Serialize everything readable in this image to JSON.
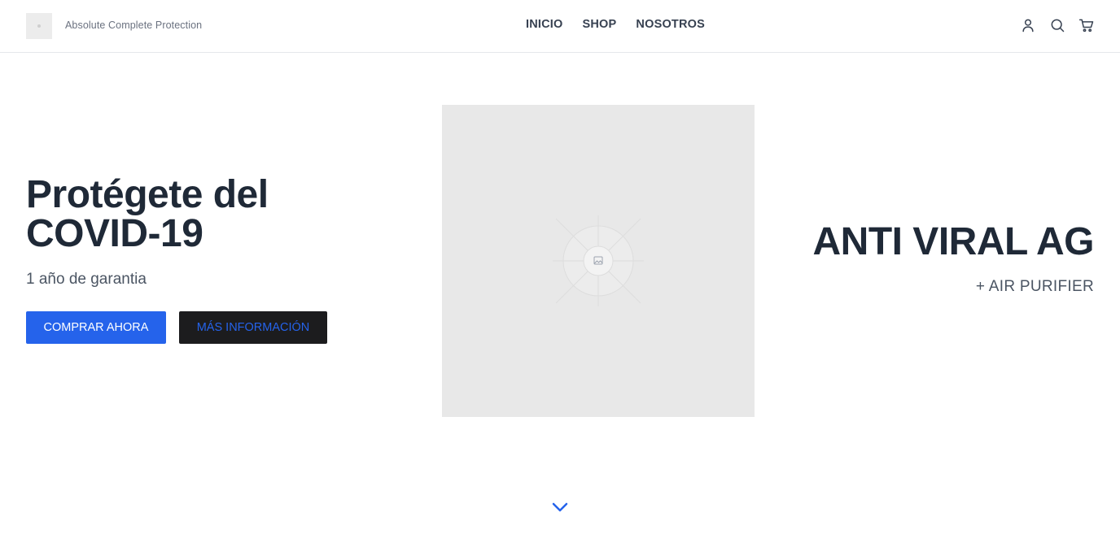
{
  "header": {
    "brand": "Absolute Complete Protection",
    "nav": [
      {
        "label": "INICIO"
      },
      {
        "label": "SHOP"
      },
      {
        "label": "NOSOTROS"
      }
    ],
    "icons": [
      "user-icon",
      "search-icon",
      "cart-icon"
    ]
  },
  "hero": {
    "title": "Protégete del COVID-19",
    "subtitle": "1 año de garantia",
    "primary_button": "COMPRAR AHORA",
    "secondary_button": "MÁS INFORMACIÓN"
  },
  "product": {
    "name": "ANTI VIRAL AG",
    "subtitle": "+ AIR PURIFIER"
  },
  "colors": {
    "accent": "#2563eb",
    "dark_button": "#1c1c1e",
    "text": "#1f2937",
    "placeholder": "#e8e8e8"
  },
  "scroll_icon": "chevron-down-icon"
}
